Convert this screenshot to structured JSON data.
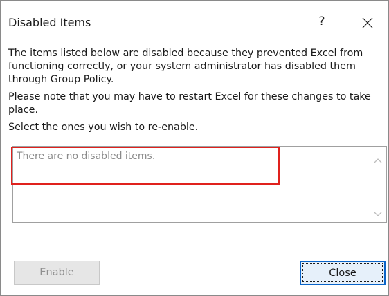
{
  "window": {
    "title": "Disabled Items",
    "help_label": "?"
  },
  "body": {
    "paragraph1": "The items listed below are disabled because they prevented Excel from functioning correctly, or your system administrator has disabled them through Group Policy.",
    "paragraph2": "Please note that you may have to restart Excel for these changes to take place.",
    "paragraph3": "Select the ones you wish to re-enable."
  },
  "list": {
    "empty_text": "There are no disabled items."
  },
  "buttons": {
    "enable_label": "Enable",
    "close_mnemonic": "C",
    "close_rest": "lose"
  },
  "colors": {
    "highlight": "#e0211d",
    "focus_border": "#0a64c8"
  },
  "icons": {
    "close": "close-icon",
    "scroll_up": "chevron-up-icon",
    "scroll_down": "chevron-down-icon"
  }
}
